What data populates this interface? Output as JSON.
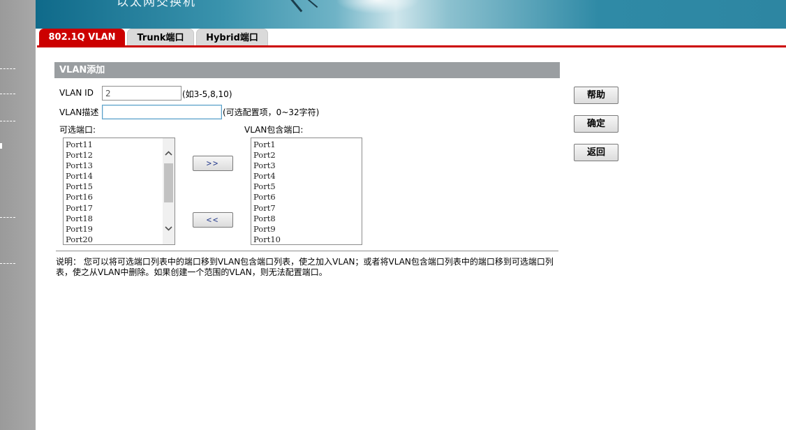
{
  "banner": {
    "title": "以太网交换机"
  },
  "tabs": [
    {
      "label": "802.1Q VLAN",
      "active": true
    },
    {
      "label": "Trunk端口",
      "active": false
    },
    {
      "label": "Hybrid端口",
      "active": false
    }
  ],
  "section": {
    "title": "VLAN添加"
  },
  "form": {
    "vlan_id_label": "VLAN ID",
    "vlan_id_value": "2",
    "vlan_id_hint": "(如3-5,8,10)",
    "desc_label": "VLAN描述",
    "desc_value": "",
    "desc_hint": "(可选配置项，0~32字符)"
  },
  "available": {
    "label": "可选端口:",
    "items": [
      "Port11",
      "Port12",
      "Port13",
      "Port14",
      "Port15",
      "Port16",
      "Port17",
      "Port18",
      "Port19",
      "Port20"
    ]
  },
  "member": {
    "label": "VLAN包含端口:",
    "items": [
      "Port1",
      "Port2",
      "Port3",
      "Port4",
      "Port5",
      "Port6",
      "Port7",
      "Port8",
      "Port9",
      "Port10"
    ]
  },
  "buttons": {
    "add": ">>",
    "remove": "<<",
    "help": "帮助",
    "ok": "确定",
    "back": "返回"
  },
  "note": "说明：  您可以将可选端口列表中的端口移到VLAN包含端口列表，使之加入VLAN；或者将VLAN包含端口列表中的端口移到可选端口列表，使之从VLAN中删除。如果创建一个范围的VLAN，则无法配置端口。",
  "colors": {
    "accent": "#cc0000",
    "section_bg": "#9a9ea1",
    "sidebar": "#a4a4a4"
  },
  "icons": {
    "scroll_up": "chevron-up-icon",
    "scroll_down": "chevron-down-icon"
  }
}
